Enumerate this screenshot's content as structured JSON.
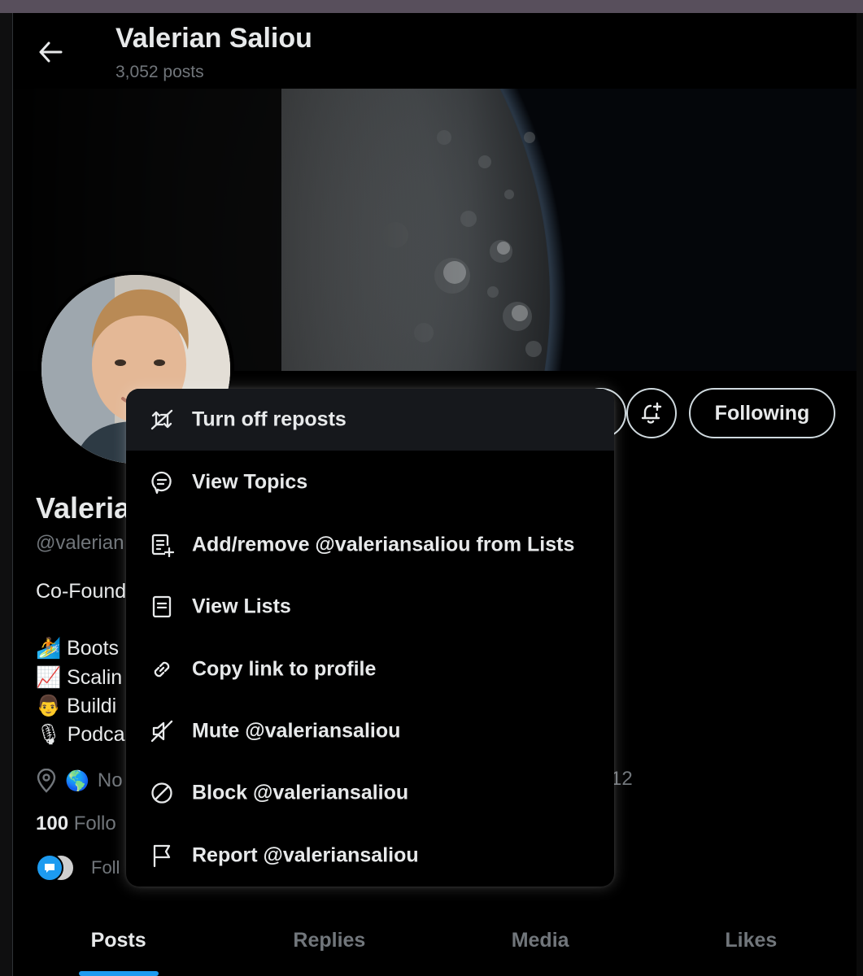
{
  "header": {
    "name": "Valerian Saliou",
    "post_count": "3,052 posts"
  },
  "profile": {
    "name_fragment": "Valeria",
    "handle_fragment": "@valerian",
    "bio_fragment": "Co-Found",
    "bio_lines": [
      {
        "emoji": "🏄",
        "text": "Boots"
      },
      {
        "emoji": "📈",
        "text": "Scalin"
      },
      {
        "emoji": "👨",
        "text": "Buildi"
      },
      {
        "emoji": "🎙",
        "text": "Podca"
      }
    ],
    "location_fragment": "No",
    "location_emoji": "🌎",
    "joined_fragment": "12",
    "following_count": "100",
    "following_label_fragment": "Follo",
    "followed_by_fragment": "Foll"
  },
  "actions": {
    "following_label": "Following"
  },
  "menu": {
    "items": [
      {
        "icon": "repost-off-icon",
        "label": "Turn off reposts"
      },
      {
        "icon": "topics-icon",
        "label": "View Topics"
      },
      {
        "icon": "list-add-icon",
        "label": "Add/remove @valeriansaliou from Lists"
      },
      {
        "icon": "list-icon",
        "label": "View Lists"
      },
      {
        "icon": "link-icon",
        "label": "Copy link to profile"
      },
      {
        "icon": "mute-icon",
        "label": "Mute @valeriansaliou"
      },
      {
        "icon": "block-icon",
        "label": "Block @valeriansaliou"
      },
      {
        "icon": "flag-icon",
        "label": "Report @valeriansaliou"
      }
    ]
  },
  "tabs": [
    {
      "label": "Posts",
      "active": true
    },
    {
      "label": "Replies",
      "active": false
    },
    {
      "label": "Media",
      "active": false
    },
    {
      "label": "Likes",
      "active": false
    }
  ],
  "colors": {
    "background": "#000000",
    "text_primary": "#e7e9ea",
    "text_secondary": "#71767b",
    "accent": "#1d9bf0",
    "menu_hover": "#16181c"
  }
}
